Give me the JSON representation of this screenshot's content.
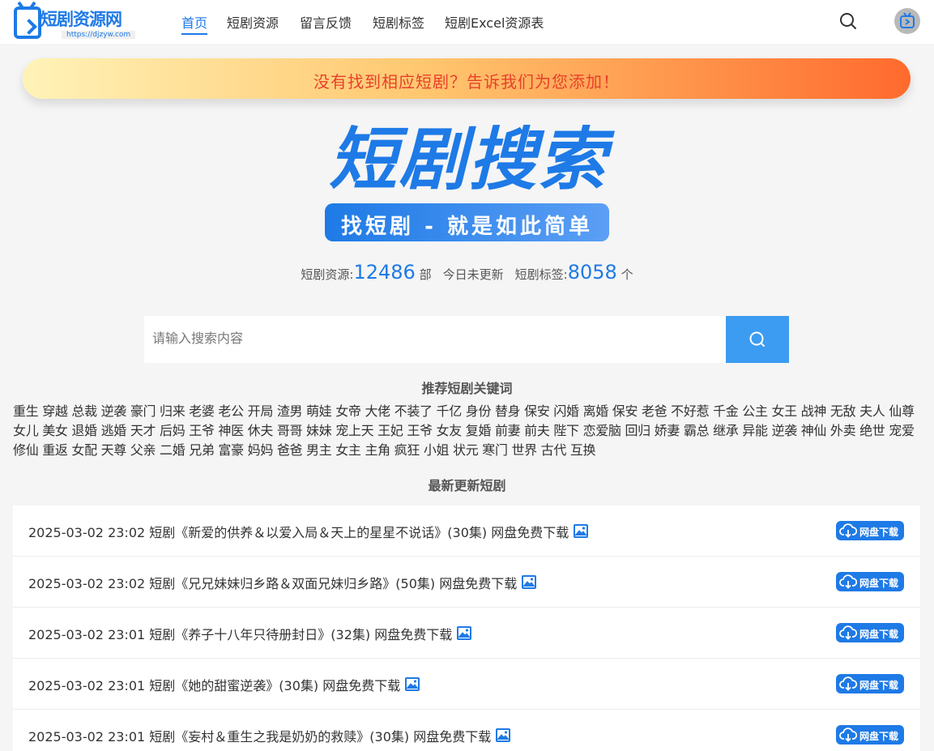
{
  "header": {
    "logo_text": "短剧资源网",
    "logo_url": "https://djzyw.com",
    "nav": [
      "首页",
      "短剧资源",
      "留言反馈",
      "短剧标签",
      "短剧Excel资源表"
    ],
    "active_index": 0
  },
  "banner": {
    "text": "没有找到相应短剧？告诉我们为您添加！"
  },
  "hero": {
    "title": "短剧搜索",
    "subtitle": "找短剧 - 就是如此简单"
  },
  "stats": {
    "resources_label": "短剧资源:",
    "resources_count": "12486",
    "resources_unit": "部",
    "today_text": "今日未更新",
    "tags_label": "短剧标签:",
    "tags_count": "8058",
    "tags_unit": "个"
  },
  "search": {
    "placeholder": "请输入搜索内容"
  },
  "keywords_title": "推荐短剧关键词",
  "keywords": [
    "重生",
    "穿越",
    "总裁",
    "逆袭",
    "豪门",
    "归来",
    "老婆",
    "老公",
    "开局",
    "渣男",
    "萌娃",
    "女帝",
    "大佬",
    "不装了",
    "千亿",
    "身份",
    "替身",
    "保安",
    "闪婚",
    "离婚",
    "保安",
    "老爸",
    "不好惹",
    "千金",
    "公主",
    "女王",
    "战神",
    "无敌",
    "夫人",
    "仙尊",
    "女儿",
    "美女",
    "退婚",
    "逃婚",
    "天才",
    "后妈",
    "王爷",
    "神医",
    "休夫",
    "哥哥",
    "妹妹",
    "宠上天",
    "王妃",
    "王爷",
    "女友",
    "复婚",
    "前妻",
    "前夫",
    "陛下",
    "恋爱脑",
    "回归",
    "娇妻",
    "霸总",
    "继承",
    "异能",
    "逆袭",
    "神仙",
    "外卖",
    "绝世",
    "宠爱",
    "修仙",
    "重返",
    "女配",
    "天尊",
    "父亲",
    "二婚",
    "兄弟",
    "富豪",
    "妈妈",
    "爸爸",
    "男主",
    "女主",
    "主角",
    "疯狂",
    "小姐",
    "状元",
    "寒门",
    "世界",
    "古代",
    "互换"
  ],
  "latest_title": "最新更新短剧",
  "latest": [
    {
      "text": "2025-03-02 23:02 短剧《新爱的供养＆以爱入局＆天上的星星不说话》(30集) 网盘免费下载",
      "button": "网盘下载"
    },
    {
      "text": "2025-03-02 23:02 短剧《兄兄妹妹归乡路＆双面兄妹归乡路》(50集) 网盘免费下载",
      "button": "网盘下载"
    },
    {
      "text": "2025-03-02 23:01 短剧《养子十八年只待册封日》(32集) 网盘免费下载",
      "button": "网盘下载"
    },
    {
      "text": "2025-03-02 23:01 短剧《她的甜蜜逆袭》(30集) 网盘免费下载",
      "button": "网盘下载"
    },
    {
      "text": "2025-03-02 23:01 短剧《妄村＆重生之我是奶奶的救赎》(30集) 网盘免费下载",
      "button": "网盘下载"
    }
  ],
  "colors": {
    "brand": "#1e7ae6",
    "search_button": "#3b9cf1",
    "banner_text": "#e8402a"
  },
  "icons": {
    "search": "search-icon",
    "avatar": "tv-icon",
    "image": "image-icon",
    "download": "cloud-download-icon"
  }
}
